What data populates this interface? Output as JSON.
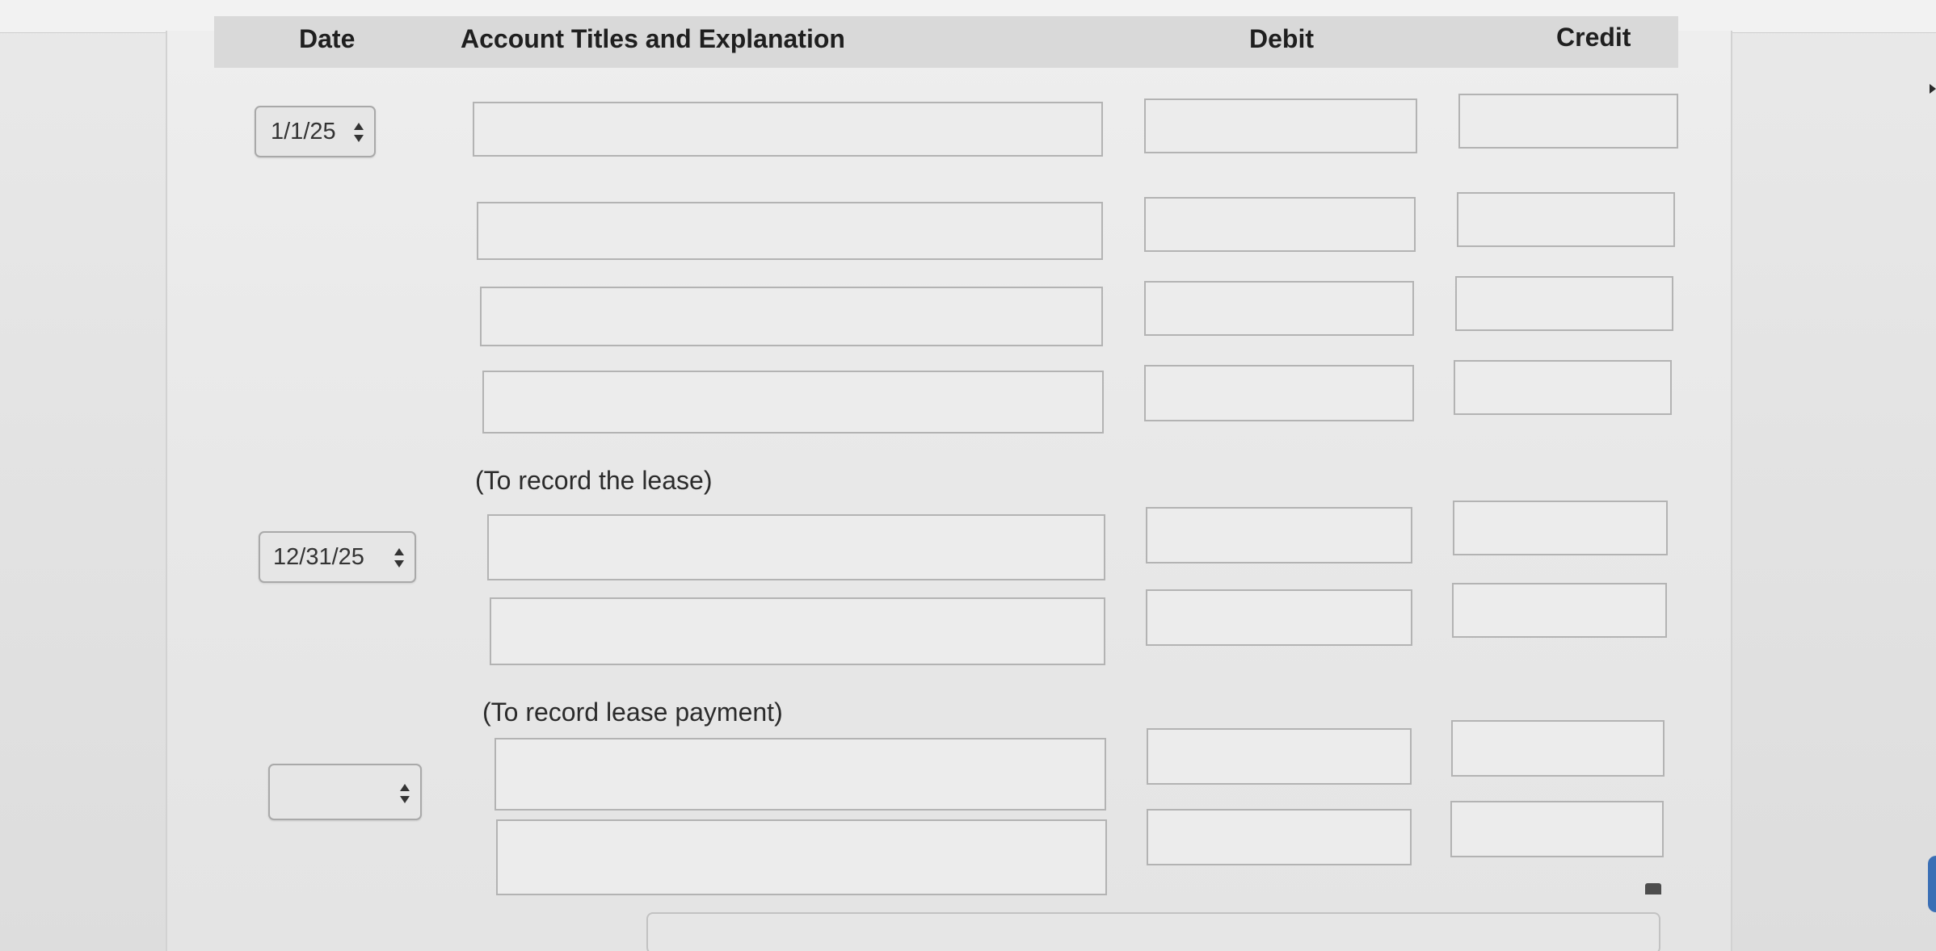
{
  "table": {
    "headers": {
      "date": "Date",
      "account": "Account Titles and Explanation",
      "debit": "Debit",
      "credit": "Credit"
    }
  },
  "entries": [
    {
      "date": "1/1/25",
      "rows": [
        {
          "account": "",
          "debit": "",
          "credit": ""
        },
        {
          "account": "",
          "debit": "",
          "credit": ""
        },
        {
          "account": "",
          "debit": "",
          "credit": ""
        },
        {
          "account": "",
          "debit": "",
          "credit": ""
        }
      ],
      "memo": "(To record the lease)"
    },
    {
      "date": "12/31/25",
      "rows": [
        {
          "account": "",
          "debit": "",
          "credit": ""
        },
        {
          "account": "",
          "debit": "",
          "credit": ""
        }
      ],
      "memo": "(To record lease payment)"
    },
    {
      "date": "",
      "rows": [
        {
          "account": "",
          "debit": "",
          "credit": ""
        },
        {
          "account": "",
          "debit": "",
          "credit": ""
        }
      ],
      "memo": ""
    }
  ],
  "icons": {
    "select_arrows": "up-down-arrows-icon"
  }
}
